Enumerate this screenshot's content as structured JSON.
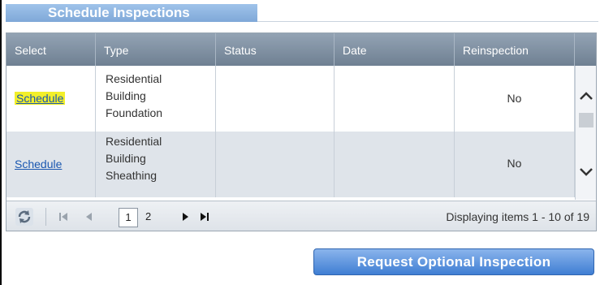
{
  "panel": {
    "title": "Schedule Inspections"
  },
  "grid": {
    "columns": [
      "Select",
      "Type",
      "Status",
      "Date",
      "Reinspection"
    ],
    "rows": [
      {
        "select": "Schedule",
        "type": [
          "Residential",
          "Building",
          "Foundation"
        ],
        "status": "",
        "date": "",
        "reinspection": "No"
      },
      {
        "select": "Schedule",
        "type": [
          "Residential",
          "Building",
          "Sheathing"
        ],
        "status": "",
        "date": "",
        "reinspection": "No"
      }
    ]
  },
  "pager": {
    "refresh_icon": "refresh-icon",
    "pages": [
      "1",
      "2"
    ],
    "current_page": "1",
    "info": "Displaying items 1 - 10 of 19"
  },
  "actions": {
    "request_button": "Request Optional Inspection"
  },
  "colors": {
    "highlight": "#f2ef2a",
    "link": "#1a57b0",
    "header": "#7f90a2",
    "button": "#3f7ed3"
  }
}
